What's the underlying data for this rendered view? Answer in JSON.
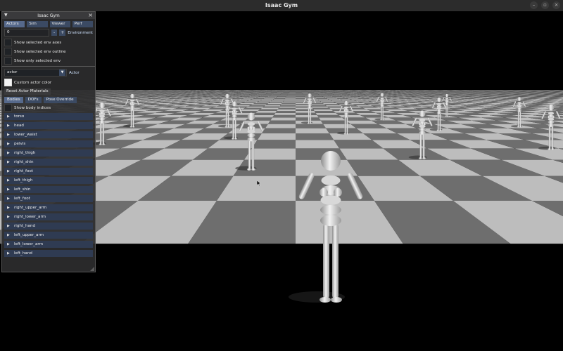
{
  "window": {
    "title": "Isaac Gym",
    "controls": [
      "–",
      "▫",
      "×"
    ]
  },
  "panel": {
    "title": "Isaac Gym",
    "main_tabs": [
      {
        "label": "Actors",
        "active": true
      },
      {
        "label": "Sim",
        "active": false
      },
      {
        "label": "Viewer",
        "active": false
      },
      {
        "label": "Perf",
        "active": false
      }
    ],
    "env_input_value": "0",
    "env_minus": "-",
    "env_plus": "+",
    "env_label": "Environment",
    "checks": [
      {
        "label": "Show selected env axes",
        "checked": false
      },
      {
        "label": "Show selected env outline",
        "checked": false
      },
      {
        "label": "Show only selected env",
        "checked": false
      }
    ],
    "actor_select_value": "actor",
    "actor_label": "Actor",
    "custom_color": {
      "label": "Custom actor color",
      "checked": true
    },
    "reset_materials_label": "Reset Actor Materials",
    "sub_tabs": [
      {
        "label": "Bodies",
        "active": true
      },
      {
        "label": "DOFs",
        "active": false
      },
      {
        "label": "Pose Override",
        "active": false
      }
    ],
    "show_body_indices": {
      "label": "Show body indices",
      "checked": false
    },
    "bodies": [
      "torso",
      "head",
      "lower_waist",
      "pelvis",
      "right_thigh",
      "right_shin",
      "right_foot",
      "left_thigh",
      "left_shin",
      "left_foot",
      "right_upper_arm",
      "right_lower_arm",
      "right_hand",
      "left_upper_arm",
      "left_lower_arm",
      "left_hand"
    ]
  },
  "colors": {
    "accent_tab": "#56698b",
    "tab": "#3b4a63",
    "panel_bg": "#2c2c2e",
    "floor_light": "#bdbdbd",
    "floor_dark": "#6e6e6e"
  }
}
